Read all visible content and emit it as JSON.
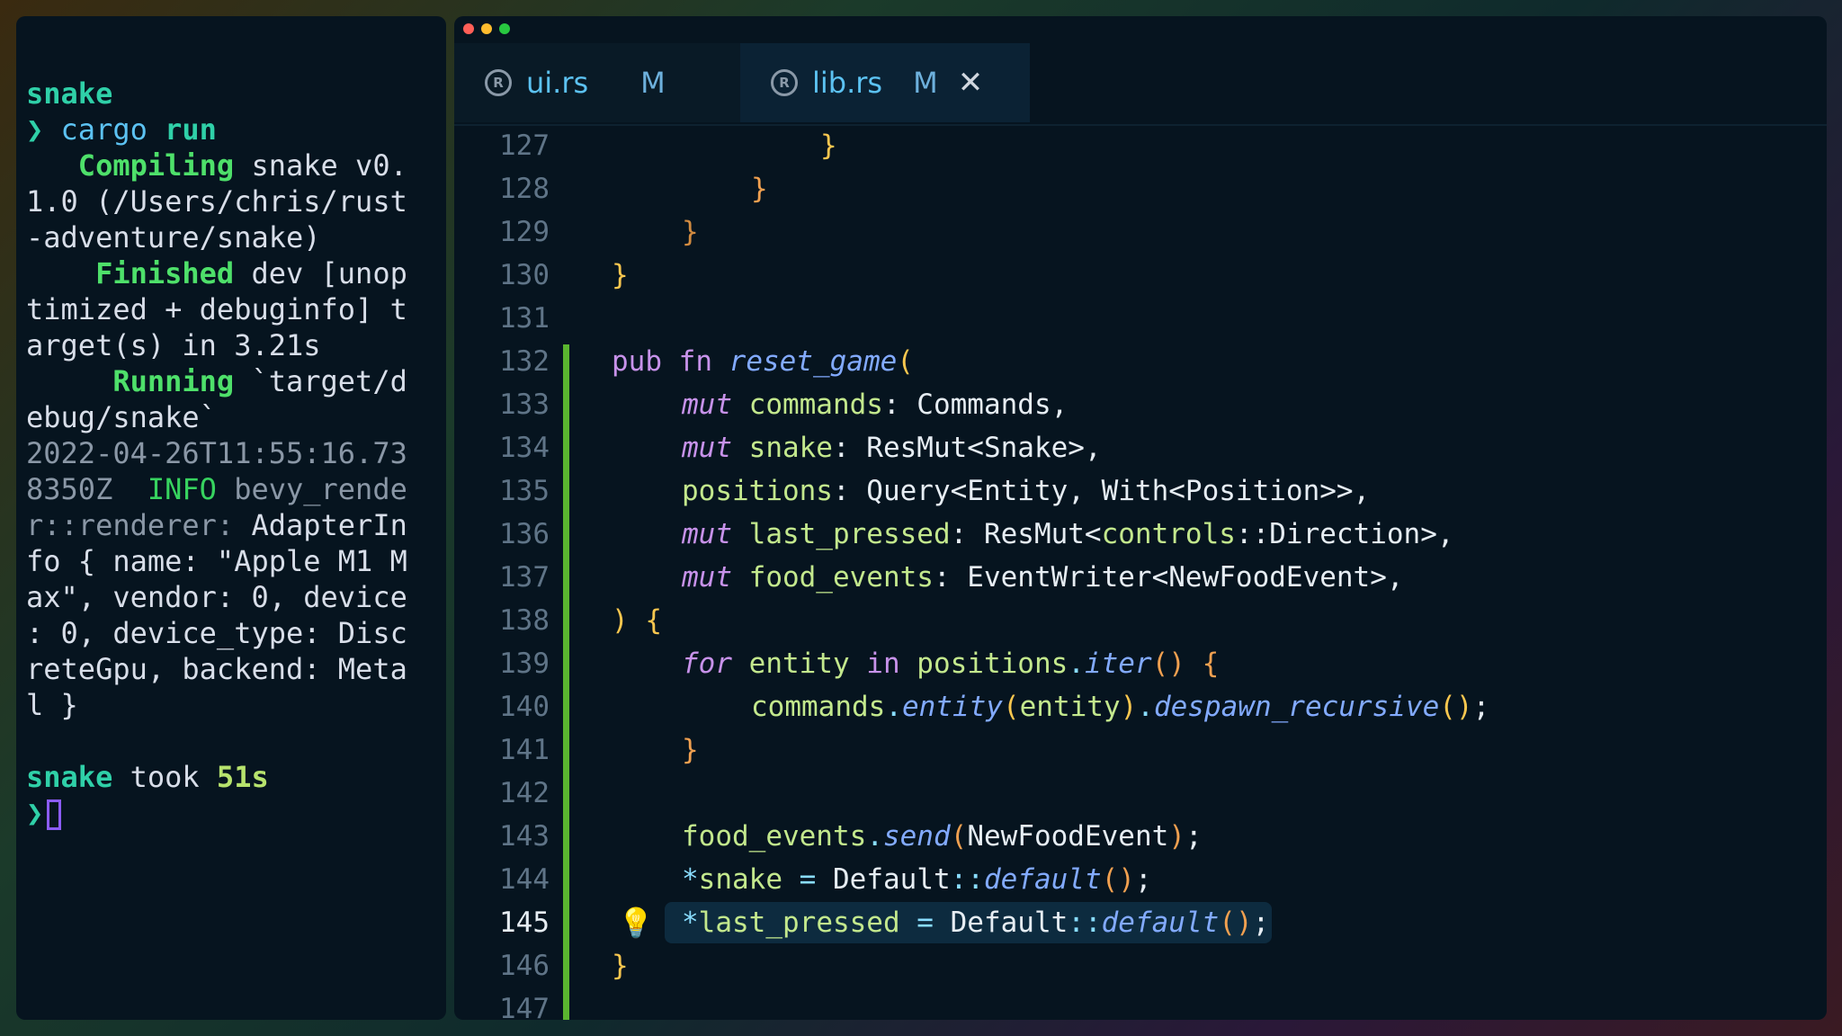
{
  "terminal": {
    "project": "snake",
    "prompt_symbol": "❯",
    "command": "cargo",
    "command_arg": "run",
    "compiling_label": "Compiling",
    "compiling_text_1": " snake v0.",
    "compiling_text_2": "1.0 (/Users/chris/rust",
    "compiling_text_3": "-adventure/snake)",
    "finished_label": "Finished",
    "finished_text_1": " dev [unop",
    "finished_text_2": "timized + debuginfo] t",
    "finished_text_3": "arget(s) in 3.21s",
    "running_label": "Running",
    "running_text_1": " `target/d",
    "running_text_2": "ebug/snake`",
    "log_1": "2022-04-26T11:55:16.73",
    "log_2_a": "8350Z",
    "log_2_level": "INFO",
    "log_2_b": " bevy_rende",
    "log_3_a": "r::renderer:",
    "log_3_b": " AdapterIn",
    "log_4": "fo { name: \"Apple M1 M",
    "log_5": "ax\", vendor: 0, device",
    "log_6": ": 0, device_type: Disc",
    "log_7": "reteGpu, backend: Meta",
    "log_8": "l }",
    "took_project": "snake",
    "took_text": " took ",
    "took_time": "51s"
  },
  "editor": {
    "tabs": [
      {
        "label": "ui.rs",
        "status": "M"
      },
      {
        "label": "lib.rs",
        "status": "M",
        "close": "✕"
      }
    ],
    "rust_icon": "R",
    "bulb": "💡",
    "line_numbers": [
      "127",
      "128",
      "129",
      "130",
      "131",
      "132",
      "133",
      "134",
      "135",
      "136",
      "137",
      "138",
      "139",
      "140",
      "141",
      "142",
      "143",
      "144",
      "145",
      "146",
      "147"
    ],
    "code": {
      "l127": "}",
      "l128": "}",
      "l129": "}",
      "l130": "}",
      "l132_kw": "pub fn ",
      "l132_fn": "reset_game",
      "l132_p": "(",
      "l133_mut": "mut ",
      "l133_name": "commands",
      "l133_rest": ": Commands,",
      "l134_mut": "mut ",
      "l134_name": "snake",
      "l134_rest": ": ResMut<Snake>,",
      "l135_name": "positions",
      "l135_rest": ": Query<Entity, With<Position>>,",
      "l136_mut": "mut ",
      "l136_name": "last_pressed",
      "l136_a": ": ResMut<",
      "l136_ns": "controls",
      "l136_b": "::Direction>,",
      "l137_mut": "mut ",
      "l137_name": "food_events",
      "l137_rest": ": EventWriter<NewFoodEvent>,",
      "l138_a": ")",
      "l138_b": " {",
      "l139_for": "for ",
      "l139_ent": "entity",
      "l139_in": " in ",
      "l139_pos": "positions",
      "l139_dot": ".",
      "l139_fn": "iter",
      "l139_paren": "()",
      "l139_brace": " {",
      "l140_cmd": "commands",
      "l140_dot": ".",
      "l140_fn": "entity",
      "l140_p1": "(",
      "l140_arg": "entity",
      "l140_p2": ")",
      "l140_dot2": ".",
      "l140_fn2": "despawn_recursive",
      "l140_p3": "()",
      "l140_semi": ";",
      "l141": "}",
      "l143_name": "food_events",
      "l143_dot": ".",
      "l143_fn": "send",
      "l143_p1": "(",
      "l143_arg": "NewFoodEvent",
      "l143_p2": ")",
      "l143_semi": ";",
      "l144_star": "*",
      "l144_name": "snake",
      "l144_eq": " = ",
      "l144_ty": "Default",
      "l144_sep": "::",
      "l144_fn": "default",
      "l144_p": "()",
      "l144_semi": ";",
      "l145_star": "*",
      "l145_name": "last_pressed",
      "l145_eq": " = ",
      "l145_ty": "Default",
      "l145_sep": "::",
      "l145_fn": "default",
      "l145_p": "()",
      "l145_semi": ";",
      "l146": "}"
    }
  }
}
